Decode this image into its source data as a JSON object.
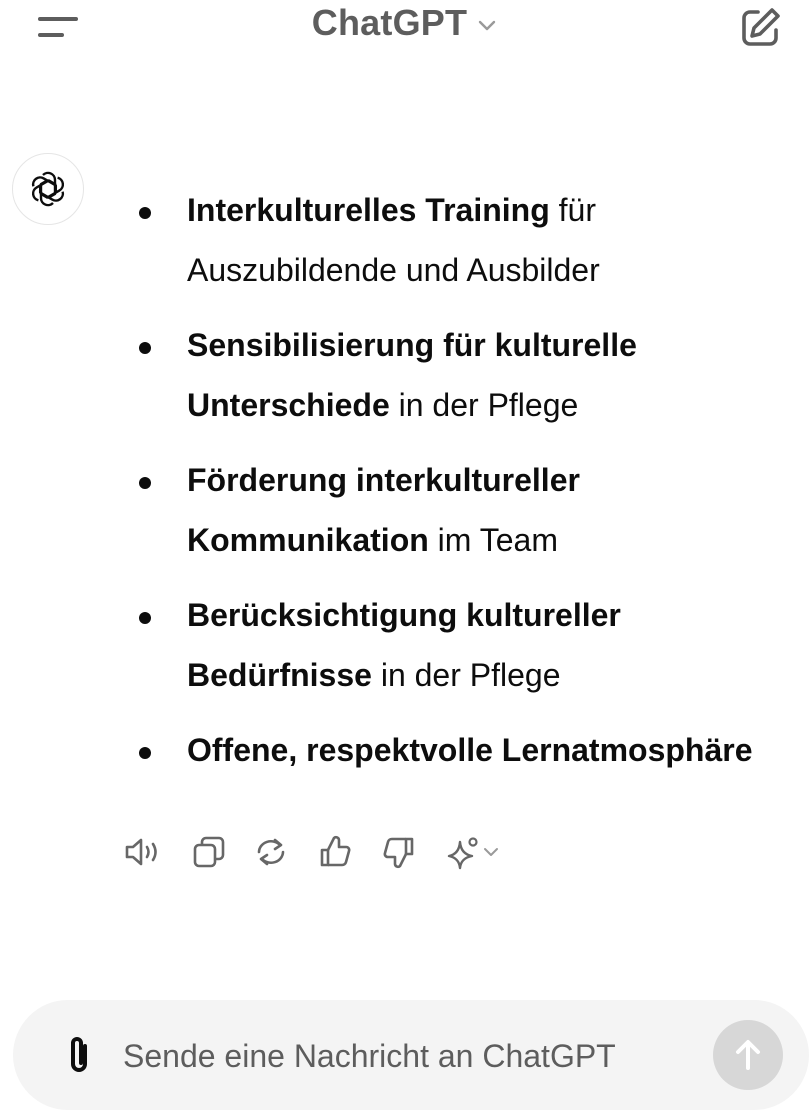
{
  "header": {
    "title": "ChatGPT",
    "menu_icon": "menu-icon",
    "title_chevron_icon": "chevron-down-icon",
    "new_chat_icon": "new-chat-icon"
  },
  "message": {
    "avatar_icon": "chatgpt-logo-icon",
    "items": [
      {
        "bold_1": "Interkulturelles Training",
        "normal_1": " für",
        "bold_2": "",
        "normal_2": "Auszubildende und Ausbilder"
      },
      {
        "bold_1": "Sensibilisierung für kulturelle",
        "normal_1": "",
        "bold_2": "Unterschiede",
        "normal_2": " in der Pflege"
      },
      {
        "bold_1": "Förderung interkultureller",
        "normal_1": "",
        "bold_2": "Kommunikation",
        "normal_2": " im Team"
      },
      {
        "bold_1": "Berücksichtigung kultureller",
        "normal_1": "",
        "bold_2": "Bedürfnisse",
        "normal_2": " in der Pflege"
      },
      {
        "bold_1": "Offene, respektvolle Lernatmosphäre",
        "normal_1": "",
        "bold_2": "",
        "normal_2": ""
      }
    ]
  },
  "actions": [
    "read-aloud-icon",
    "copy-icon",
    "regenerate-icon",
    "thumbs-up-icon",
    "thumbs-down-icon",
    "sparkle-model-icon",
    "chevron-down-icon"
  ],
  "composer": {
    "placeholder": "Sende eine Nachricht an ChatGPT",
    "attach_icon": "paperclip-icon",
    "send_icon": "arrow-up-icon"
  },
  "colors": {
    "text": "#0d0d0d",
    "muted": "#5d5d5d",
    "icon": "#676767",
    "composer_bg": "#f4f4f4",
    "send_disabled": "#d7d7d7"
  }
}
